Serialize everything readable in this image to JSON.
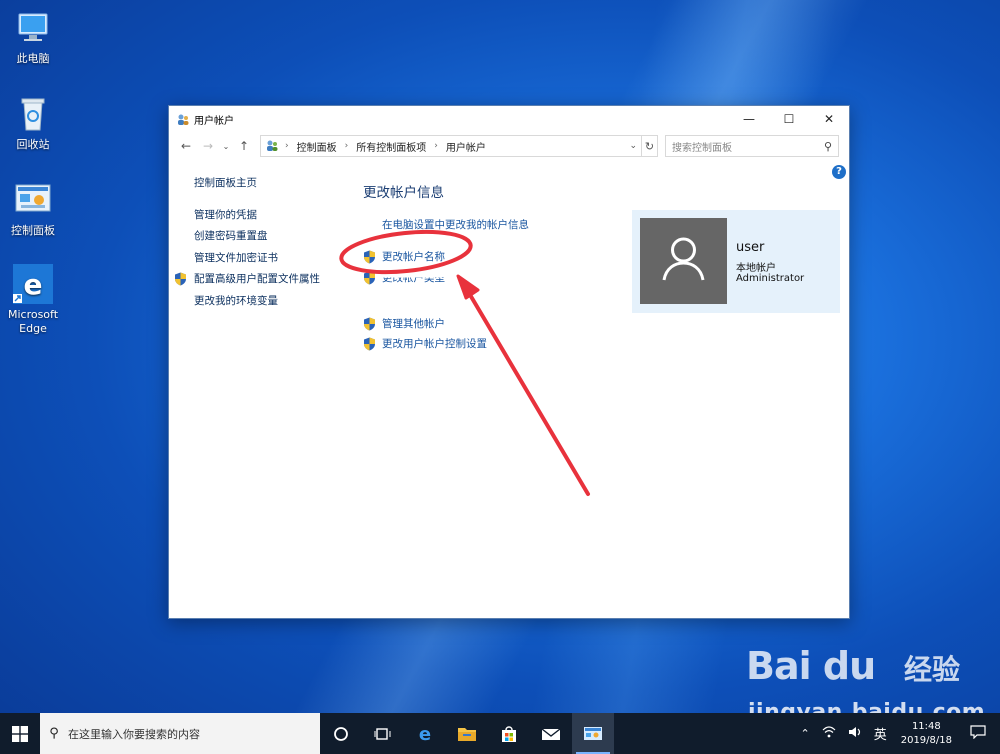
{
  "desktop": {
    "icons": [
      {
        "label": "此电脑",
        "icon": "computer-icon"
      },
      {
        "label": "回收站",
        "icon": "recycle-bin-icon"
      },
      {
        "label": "控制面板",
        "icon": "control-panel-icon"
      },
      {
        "label": "Microsoft Edge",
        "icon": "edge-icon"
      }
    ]
  },
  "window": {
    "title": "用户帐户",
    "controls": {
      "minimize": "—",
      "maximize": "☐",
      "close": "✕"
    },
    "address": {
      "crumbs": [
        "控制面板",
        "所有控制面板项",
        "用户帐户"
      ],
      "search_placeholder": "搜索控制面板"
    },
    "left_pane": [
      {
        "label": "控制面板主页",
        "shield": false
      },
      {
        "label": "管理你的凭据",
        "shield": false
      },
      {
        "label": "创建密码重置盘",
        "shield": false
      },
      {
        "label": "管理文件加密证书",
        "shield": false
      },
      {
        "label": "配置高级用户配置文件属性",
        "shield": true
      },
      {
        "label": "更改我的环境变量",
        "shield": false
      }
    ],
    "main": {
      "heading": "更改帐户信息",
      "links": {
        "pc_settings": "在电脑设置中更改我的帐户信息",
        "change_name": "更改帐户名称",
        "change_type": "更改帐户类型",
        "manage_other": "管理其他帐户",
        "uac": "更改用户帐户控制设置"
      }
    },
    "user": {
      "name": "user",
      "type": "本地帐户",
      "role": "Administrator"
    }
  },
  "taskbar": {
    "search_placeholder": "在这里输入你要搜索的内容",
    "ime": "英",
    "time": "11:48",
    "date": "2019/8/18"
  },
  "watermark": {
    "logo": "Bai du",
    "jingyan": "经验",
    "url": "jingyan.baidu.com"
  },
  "colors": {
    "accent": "#1a56a0",
    "annotation": "#e8323c",
    "user_card": "#e5f1fb"
  }
}
